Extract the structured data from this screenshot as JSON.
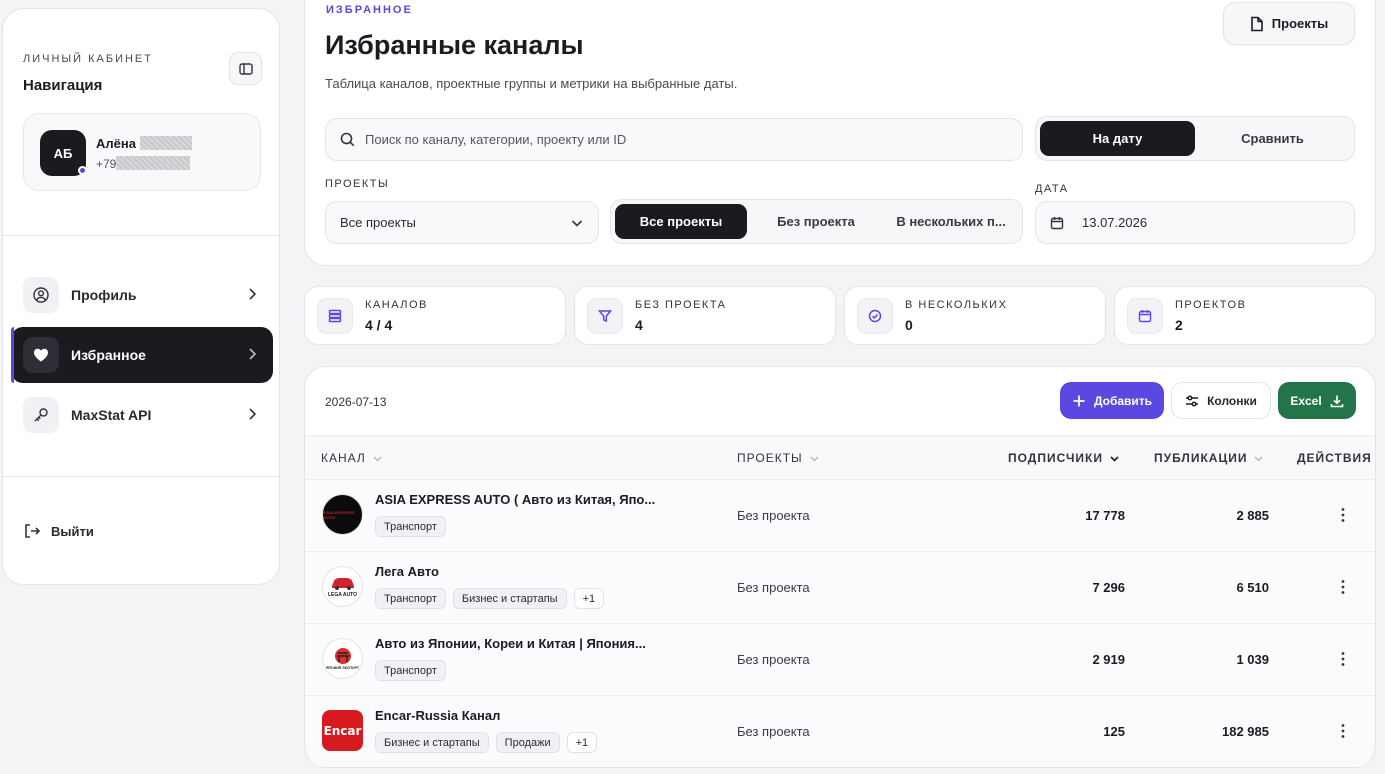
{
  "sidebar": {
    "kicker": "ЛИЧНЫЙ КАБИНЕТ",
    "title": "Навигация",
    "user": {
      "initials": "АБ",
      "name": "Алёна",
      "phone_prefix": "+79"
    },
    "nav": [
      {
        "label": "Профиль",
        "icon": "user-circle-icon"
      },
      {
        "label": "Избранное",
        "icon": "heart-icon",
        "active": true
      },
      {
        "label": "MaxStat API",
        "icon": "key-icon"
      }
    ],
    "logout": "Выйти"
  },
  "header": {
    "kicker": "ИЗБРАННОЕ",
    "title": "Избранные каналы",
    "subtitle": "Таблица каналов, проектные группы и метрики на выбранные даты.",
    "projects_button": "Проекты",
    "search_placeholder": "Поиск по каналу, категории, проекту или ID",
    "date_modes": [
      "На дату",
      "Сравнить"
    ],
    "projects_label": "ПРОЕКТЫ",
    "projects_select": "Все проекты",
    "project_filters": [
      "Все проекты",
      "Без проекта",
      "В нескольких п..."
    ],
    "date_label": "ДАТА",
    "date_value": "13.07.2026"
  },
  "stats": [
    {
      "label": "КАНАЛОВ",
      "value": "4 / 4",
      "icon": "list-icon"
    },
    {
      "label": "БЕЗ ПРОЕКТА",
      "value": "4",
      "icon": "filter-icon"
    },
    {
      "label": "В НЕСКОЛЬКИХ",
      "value": "0",
      "icon": "check-circle-icon"
    },
    {
      "label": "ПРОЕКТОВ",
      "value": "2",
      "icon": "calendar-icon"
    }
  ],
  "table": {
    "date": "2026-07-13",
    "add_button": "Добавить",
    "columns_button": "Колонки",
    "excel_button": "Excel",
    "headers": [
      "КАНАЛ",
      "ПРОЕКТЫ",
      "ПОДПИСЧИКИ",
      "ПУБЛИКАЦИИ",
      "ДЕЙСТВИЯ"
    ],
    "rows": [
      {
        "name": "ASIA EXPRESS AUTO ( Авто из Китая, Япо...",
        "tags": [
          "Транспорт"
        ],
        "more": "",
        "project": "Без проекта",
        "subscribers": "17 778",
        "publications": "2 885",
        "logo_bg": "#0b0b0b",
        "logo_fg": "#c7242b",
        "logo_text": "ASIA EXPRESS AUTO"
      },
      {
        "name": "Лега Авто",
        "tags": [
          "Транспорт",
          "Бизнес и стартапы"
        ],
        "more": "+1",
        "project": "Без проекта",
        "subscribers": "7 296",
        "publications": "6 510",
        "logo_bg": "#ffffff",
        "logo_fg": "#d0232b",
        "logo_text": "LEGA AUTO"
      },
      {
        "name": "Авто из Японии, Кореи и Китая | Япония...",
        "tags": [
          "Транспорт"
        ],
        "more": "",
        "project": "Без проекта",
        "subscribers": "2 919",
        "publications": "1 039",
        "logo_bg": "#ffffff",
        "logo_fg": "#d9302b",
        "logo_text": "ЯПОНИЯ ЭКСПОРТ"
      },
      {
        "name": "Encar-Russia Канал",
        "tags": [
          "Бизнес и стартапы",
          "Продажи"
        ],
        "more": "+1",
        "project": "Без проекта",
        "subscribers": "125",
        "publications": "182 985",
        "logo_bg": "#d71a20",
        "logo_fg": "#ffffff",
        "logo_text": "Encar"
      }
    ]
  },
  "colors": {
    "accent": "#5b48e0",
    "dark": "#1a1a1f",
    "excel": "#23744b"
  }
}
